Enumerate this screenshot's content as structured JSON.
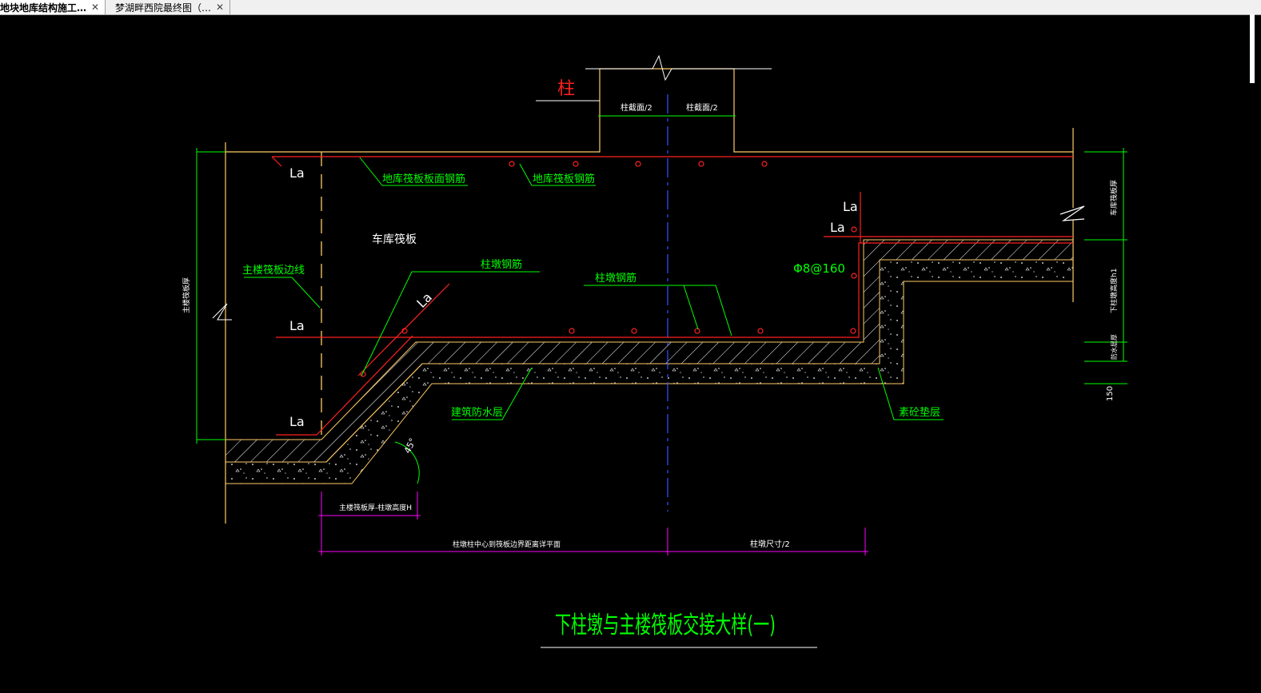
{
  "tabs": [
    {
      "label": "地块地库结构施工…",
      "close": "✕"
    },
    {
      "label": "梦湖畔西院最终图（…",
      "close": "✕"
    }
  ],
  "drawing": {
    "column_label": "柱",
    "col_half_left": "柱截面/2",
    "col_half_right": "柱截面/2",
    "la_labels": [
      "La",
      "La",
      "La",
      "La",
      "La",
      "La"
    ],
    "la_slant": "La",
    "garage_top_rebar": "地库筏板板面钢筋",
    "garage_rebar": "地库筏板钢筋",
    "garage_raft": "车库筏板",
    "main_edge_line": "主楼筏板边线",
    "pier_rebar_1": "柱墩钢筋",
    "pier_rebar_2": "柱墩钢筋",
    "phi_spacing": "Φ8@160",
    "waterproof": "建筑防水层",
    "cushion": "素砼垫层",
    "angle": "45°",
    "left_dim": "主楼筏板厚",
    "right_dim_1": "车库筏板厚",
    "right_dim_2": "下柱墩高度h1",
    "right_dim_3": "防水层厚",
    "right_dim_150": "150",
    "bottom_dim_small": "主楼筏板厚-柱墩高度H",
    "bottom_dim_left": "柱墩柱中心到筏板边界距离详平面",
    "bottom_dim_right": "柱墩尺寸/2",
    "title": "下柱墩与主楼筏板交接大样(一)"
  },
  "colors": {
    "background": "#000000",
    "outline": "#ffcc66",
    "rebar": "#ff2020",
    "leader": "#00ff00",
    "dimension": "#ff00ff",
    "text_white": "#ffffff",
    "centerline": "#3355ff"
  }
}
